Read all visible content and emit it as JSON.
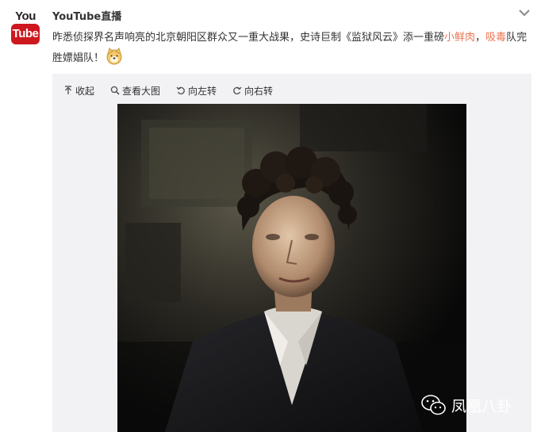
{
  "avatar": {
    "logo_top": "You",
    "logo_bottom": "Tube"
  },
  "author": {
    "name": "YouTube直播"
  },
  "post": {
    "text_1": "昨悉侦探界名声响亮的北京朝阳区群众又一重大战果，史诗巨制《监狱风云》添一重磅",
    "highlight_1": "小鲜肉",
    "text_2": "，",
    "highlight_2": "吸毒",
    "text_3": "队完胜嫖娼队！"
  },
  "toolbar": {
    "collapse": "收起",
    "view_large": "查看大图",
    "rotate_left": "向左转",
    "rotate_right": "向右转"
  },
  "watermark": {
    "text": "凤凰八卦"
  },
  "icons": [
    "chevron-down-icon",
    "arrow-up-icon",
    "magnifier-icon",
    "rotate-left-icon",
    "rotate-right-icon",
    "wechat-icon",
    "doge-emoji-icon"
  ],
  "colors": {
    "link_red": "#eb7350",
    "youtube_red": "#cc181e",
    "media_bg": "#f2f2f5"
  }
}
